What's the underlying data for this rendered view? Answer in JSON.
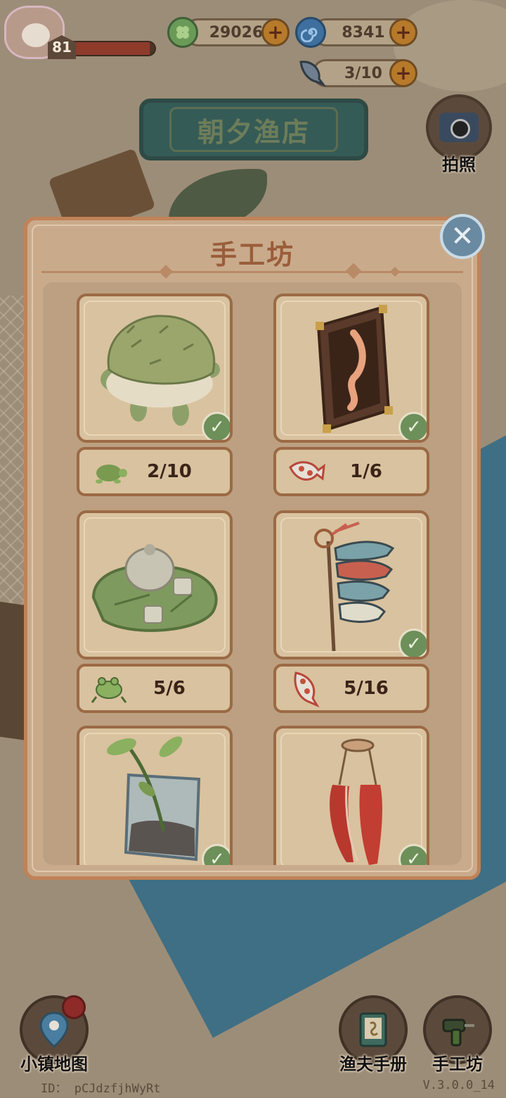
{
  "player": {
    "level": "81",
    "level_progress": 0.95
  },
  "currencies": {
    "clover": {
      "value": "29026",
      "icon": "clover-coin-icon",
      "color": "#6a9a58"
    },
    "shell": {
      "value": "8341",
      "icon": "swirl-shell-icon",
      "color": "#3e6f9e"
    },
    "fish": {
      "value": "3/10",
      "icon": "fish-stamina-icon",
      "color": "#6f7f8f"
    }
  },
  "location": {
    "shop_name": "朝夕渔店"
  },
  "photo": {
    "label": "拍照",
    "icon": "camera-icon"
  },
  "panel": {
    "title": "手工坊",
    "close_icon": "close-icon",
    "items": [
      {
        "name": "turtle-shell-bed",
        "icon": "turtle-icon",
        "progress": "2/10",
        "completed": true
      },
      {
        "name": "koi-painting",
        "icon": "koi-fish-icon",
        "progress": "1/6",
        "completed": true
      },
      {
        "name": "lotus-tea-set",
        "icon": "frog-icon",
        "progress": "5/6",
        "completed": false
      },
      {
        "name": "carp-streamers",
        "icon": "koi-fish-icon",
        "progress": "5/16",
        "completed": true
      },
      {
        "name": "glass-terrarium",
        "icon": "plant-icon",
        "progress": "",
        "completed": true
      },
      {
        "name": "dried-crayfish",
        "icon": "crayfish-icon",
        "progress": "",
        "completed": true
      }
    ]
  },
  "nav": {
    "map_label": "小镇地图",
    "handbook_label": "渔夫手册",
    "workshop_label": "手工坊"
  },
  "footer": {
    "id_text": "ID： pCJdzfjhWyRt",
    "version": "V.3.0.0_14"
  },
  "colors": {
    "accent_orange": "#c18257",
    "check_green": "#6d8f5a",
    "close_blue": "#6a8aa2"
  }
}
